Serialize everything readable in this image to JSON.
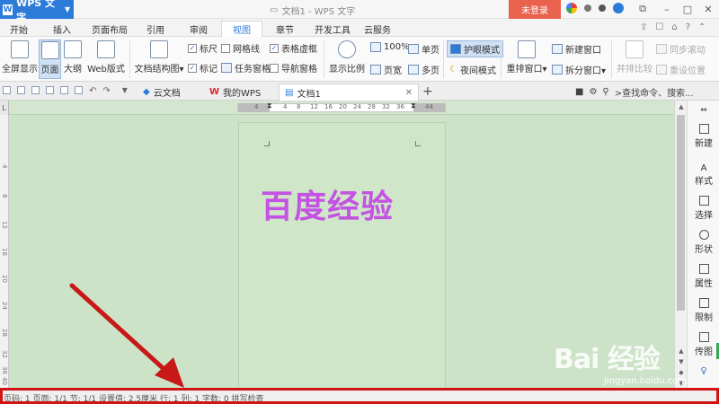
{
  "app": {
    "name": "WPS 文字",
    "title": "文档1 - WPS 文字",
    "login": "未登录"
  },
  "menu": {
    "tabs": [
      "开始",
      "插入",
      "页面布局",
      "引用",
      "审阅",
      "视图",
      "章节",
      "开发工具",
      "云服务"
    ],
    "active": "视图"
  },
  "ribbon": {
    "fullscreen": "全屏显示",
    "page_view": "页面",
    "outline": "大纲",
    "web_view": "Web版式",
    "doc_map": "文档结构图",
    "ruler": "标尺",
    "gridlines": "网格线",
    "table_gridlines": "表格虚框",
    "markup": "标记",
    "task_pane": "任务窗格",
    "nav_pane": "导航窗格",
    "zoom": "显示比例",
    "zoom_100": "100%",
    "page_width": "页宽",
    "one_page": "单页",
    "multi_page": "多页",
    "eye_mode": "护眼模式",
    "night_mode": "夜间模式",
    "arrange": "重排窗口",
    "new_window": "新建窗口",
    "split": "拆分窗口",
    "side_by_side": "并排比较",
    "sync_scroll": "同步滚动",
    "reset_pos": "重设位置"
  },
  "tabs": {
    "items": [
      {
        "label": "云文档"
      },
      {
        "label": "我的WPS"
      },
      {
        "label": "文档1"
      }
    ],
    "search_hint": ">查找命令、搜索..."
  },
  "ruler": {
    "h_labels": [
      "4",
      "4",
      "8",
      "12",
      "16",
      "20",
      "24",
      "28",
      "32",
      "36",
      "44"
    ],
    "v_labels": [
      "4",
      "8",
      "12",
      "16",
      "20",
      "24",
      "28",
      "32",
      "36",
      "40"
    ],
    "corner": "L"
  },
  "document": {
    "content": "百度经验"
  },
  "side_panel": {
    "items": [
      "新建",
      "样式",
      "选择",
      "形状",
      "属性",
      "限制",
      "传图"
    ]
  },
  "status": {
    "text": "页码: 1  页面: 1/1  节: 1/1  设置值: 2.5厘米  行: 1  列: 1  字数: 0  拼写检查"
  },
  "watermark": {
    "brand": "Bai 经验",
    "url": "jingyan.baidu.com"
  },
  "colors": {
    "wps_blue": "#2c7bd9",
    "login_red": "#e8624e",
    "eye_green": "#cde3c8",
    "text_purple": "#c452e3",
    "highlight_red": "#d01414"
  }
}
